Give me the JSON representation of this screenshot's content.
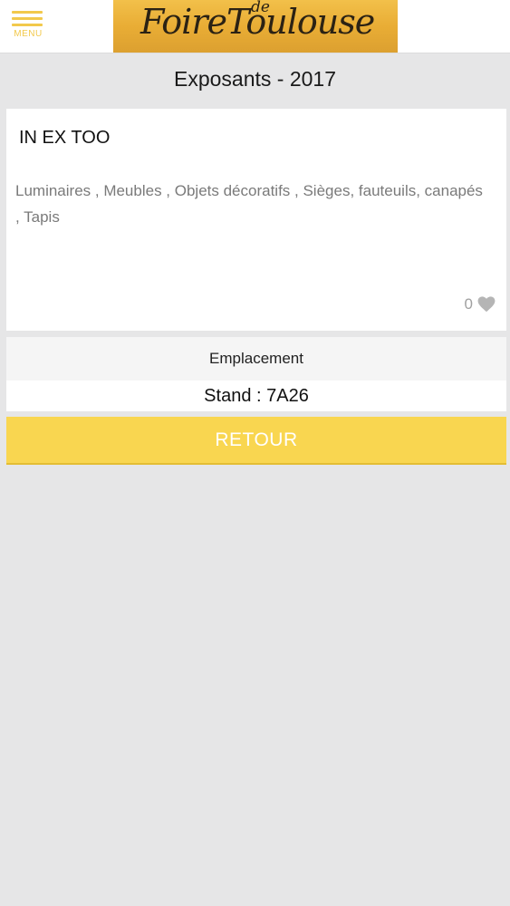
{
  "header": {
    "menu_label": "MENU",
    "logo_main": "FoireToulouse",
    "logo_de": "de"
  },
  "page": {
    "title": "Exposants - 2017"
  },
  "exhibitor": {
    "name": "IN EX TOO",
    "categories": "Luminaires , Meubles , Objets décoratifs , Sièges, fauteuils, canapés , Tapis",
    "likes": "0"
  },
  "location": {
    "label": "Emplacement",
    "stand": "Stand : 7A26"
  },
  "actions": {
    "back_label": "RETOUR"
  },
  "colors": {
    "accent_yellow": "#f9d650",
    "logo_gold": "#e9ad35",
    "background": "#e6e6e7"
  }
}
